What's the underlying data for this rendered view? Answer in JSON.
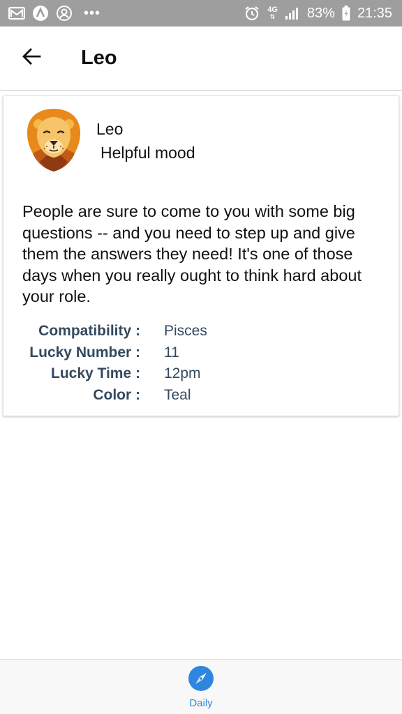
{
  "status_bar": {
    "network": "4G",
    "battery": "83%",
    "time": "21:35",
    "icons": [
      "gmail-icon",
      "a-icon",
      "account-icon",
      "more-dots-icon",
      "alarm-icon",
      "network-4g-icon",
      "signal-icon",
      "battery-icon"
    ]
  },
  "header": {
    "title": "Leo",
    "back_icon": "arrow-left-icon"
  },
  "card": {
    "avatar_icon": "lion-avatar-icon",
    "sign": "Leo",
    "mood": "Helpful mood",
    "horoscope": "People are sure to come to you with some big questions -- and you need to step up and give them the answers they need! It's one of those days when you really ought to think hard about your role.",
    "details": [
      {
        "label": "Compatibility :",
        "value": "Pisces"
      },
      {
        "label": "Lucky Number :",
        "value": "11"
      },
      {
        "label": "Lucky Time :",
        "value": "12pm"
      },
      {
        "label": "Color :",
        "value": "Teal"
      }
    ]
  },
  "bottom_nav": {
    "items": [
      {
        "label": "Daily",
        "icon": "compass-icon"
      }
    ]
  },
  "colors": {
    "status_bar": "#9e9e9e",
    "accent": "#2e86de",
    "detail_text": "#34495e"
  }
}
